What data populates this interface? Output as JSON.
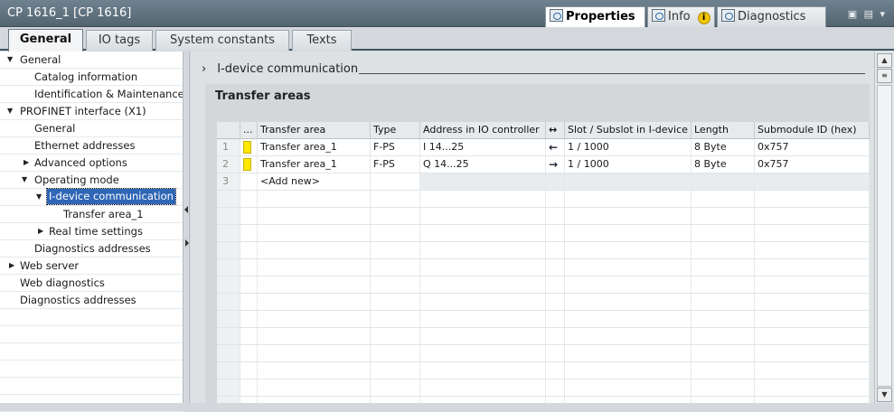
{
  "window": {
    "title": "CP 1616_1 [CP 1616]",
    "panel_tabs": [
      {
        "label": "Properties",
        "icon": "properties-icon"
      },
      {
        "label": "Info",
        "icon": "info-icon"
      },
      {
        "label": "Diagnostics",
        "icon": "diagnostics-icon"
      }
    ],
    "info_badge": "i",
    "window_controls": "▣ ▤ ▾"
  },
  "tabs": [
    {
      "label": "General"
    },
    {
      "label": "IO tags"
    },
    {
      "label": "System constants"
    },
    {
      "label": "Texts"
    }
  ],
  "tree": [
    {
      "label": "General",
      "expanded": true
    },
    {
      "label": "Catalog information"
    },
    {
      "label": "Identification & Maintenance"
    },
    {
      "label": "PROFINET interface (X1)",
      "expanded": true
    },
    {
      "label": "General"
    },
    {
      "label": "Ethernet addresses"
    },
    {
      "label": "Advanced options",
      "expanded": false
    },
    {
      "label": "Operating mode",
      "expanded": true
    },
    {
      "label": "I-device communication",
      "expanded": true,
      "selected": true
    },
    {
      "label": "Transfer area_1"
    },
    {
      "label": "Real time settings",
      "expanded": false
    },
    {
      "label": "Diagnostics addresses"
    },
    {
      "label": "Web server",
      "expanded": false
    },
    {
      "label": "Web diagnostics"
    },
    {
      "label": "Diagnostics addresses"
    }
  ],
  "content": {
    "breadcrumb": "I-device communication",
    "section_title": "Transfer areas",
    "table": {
      "headers": [
        "...",
        "Transfer area",
        "Type",
        "Address in IO controller",
        "↔",
        "Slot / Subslot in I-device",
        "Length",
        "Submodule ID (hex)"
      ],
      "rows": [
        {
          "num": "1",
          "name": "Transfer area_1",
          "type": "F-PS",
          "address": "I 14...25",
          "direction": "←",
          "slot": "1 / 1000",
          "length": "8 Byte",
          "submodule": "0x757"
        },
        {
          "num": "2",
          "name": "Transfer area_1",
          "type": "F-PS",
          "address": "Q 14...25",
          "direction": "→",
          "slot": "1 / 1000",
          "length": "8 Byte",
          "submodule": "0x757"
        },
        {
          "num": "3",
          "name": "<Add new>"
        }
      ]
    }
  },
  "colors": {
    "titlebar": "#5f717c",
    "selection": "#2f66b6",
    "transfer_area_marker": "#ffe800"
  }
}
